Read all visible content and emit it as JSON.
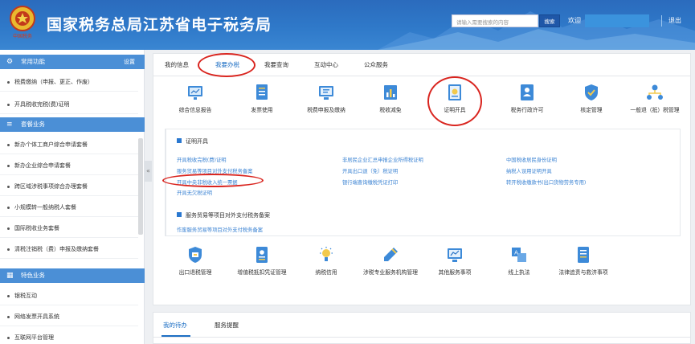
{
  "header": {
    "title": "国家税务总局江苏省电子税务局",
    "emblem_text": "中国税务",
    "search_placeholder": "请输入需要搜索的内容",
    "search_button": "搜索",
    "welcome": "欢迎",
    "exit": "退出"
  },
  "sidebar": {
    "common": {
      "title": "常用功能",
      "settings": "设置",
      "items": [
        "税费缴纳（申报、更正、作废）",
        "开具税收完税(费)证明"
      ]
    },
    "packages": {
      "title": "套餐业务",
      "items": [
        "新办个体工商户综合申请套餐",
        "新办企业综合申请套餐",
        "跨区域涉税事项综合办理套餐",
        "小规模转一般纳税人套餐",
        "国际税收业务套餐",
        "清税注销税（费）申报及缴纳套餐"
      ]
    },
    "special": {
      "title": "特色业务",
      "items": [
        "银税互动",
        "网络发票开具系统",
        "互联网平台管理"
      ]
    },
    "collapse": "«"
  },
  "main": {
    "tabs": [
      "我的信息",
      "我要办税",
      "我要查询",
      "互动中心",
      "公众服务"
    ],
    "services_top": [
      "综合信息报告",
      "发票使用",
      "税费申报及缴纳",
      "税收减免",
      "证明开具",
      "税务行政许可",
      "核定管理",
      "一般退（抵）税管理"
    ],
    "section1_title": "证明开具",
    "links": {
      "col1": [
        "开具税收完税(费)证明",
        "服务贸易等项目对外支付税务备案",
        "开具中央非税收入统一票据",
        "开具无欠税证明"
      ],
      "col2": [
        "非居民企业汇总申报企业所得税证明",
        "开具出口退（免）税证明",
        "银行端查询缴税凭证打印"
      ],
      "col3": [
        "中国税收居民身份证明",
        "纳税人误用证明开具",
        "转开税收缴款书(出口货物劳务专用)"
      ]
    },
    "section2_title": "服务贸易等项目对外支付税务备案",
    "section2_links": [
      "作废服务贸易等项目对外支付税务备案"
    ],
    "services_bottom": [
      "出口退税管理",
      "增值税抵扣凭证管理",
      "纳税信用",
      "涉税专业服务机构管理",
      "其他服务事项",
      "线上执法",
      "法律追责与救济事项"
    ]
  },
  "bottom": {
    "tabs": [
      "我的待办",
      "服务提醒"
    ]
  },
  "colors": {
    "header": "#2f79c9",
    "accent": "#1e6fc4",
    "link": "#3b83d3",
    "annotation": "#d9251f",
    "sidebar_head": "#4b8fd6"
  },
  "icons": {
    "services_top": [
      "report-screen-icon",
      "invoice-document-icon",
      "monitor-declare-icon",
      "tax-reduction-chart-icon",
      "certificate-icon",
      "license-id-icon",
      "verify-shield-icon",
      "refund-network-icon"
    ],
    "services_bottom": [
      "export-shield-icon",
      "deduction-id-icon",
      "credit-lamp-icon",
      "agency-pen-icon",
      "other-services-icon",
      "online-enforcement-icon",
      "legal-book-icon"
    ]
  }
}
